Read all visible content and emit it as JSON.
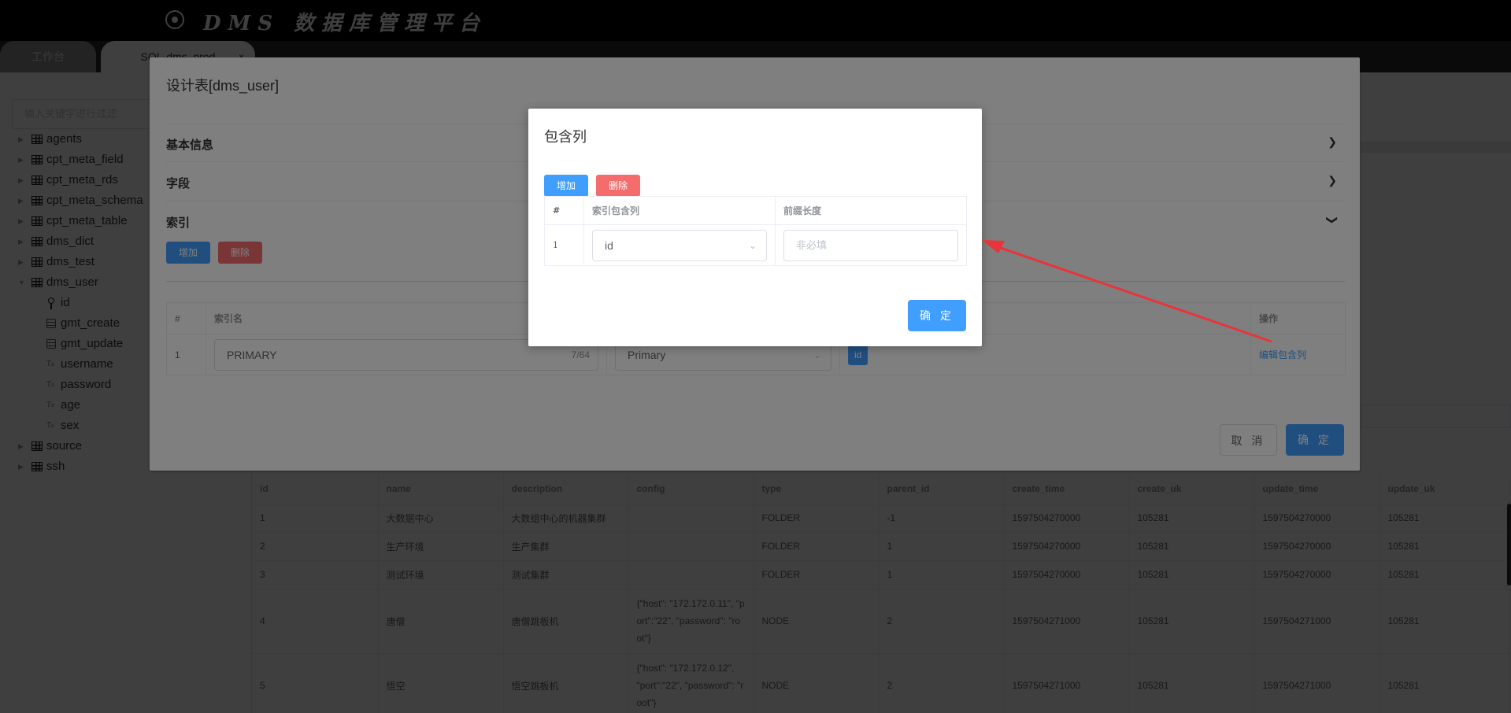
{
  "app": {
    "title": "DMS 数据库管理平台",
    "logo_icon": "gear-logo-icon"
  },
  "tabs": [
    {
      "label": "工作台"
    },
    {
      "label": "SQL-dms_prod",
      "close": "×"
    }
  ],
  "sidebar": {
    "filter_placeholder": "输入关键字进行过滤",
    "tables": [
      {
        "name": "agents"
      },
      {
        "name": "cpt_meta_field"
      },
      {
        "name": "cpt_meta_rds"
      },
      {
        "name": "cpt_meta_schema"
      },
      {
        "name": "cpt_meta_table"
      },
      {
        "name": "dms_dict"
      },
      {
        "name": "dms_test"
      },
      {
        "name": "dms_user",
        "expanded": true,
        "columns": [
          {
            "name": "id",
            "icon": "key-icon"
          },
          {
            "name": "gmt_create",
            "icon": "datetime-icon"
          },
          {
            "name": "gmt_update",
            "icon": "datetime-icon"
          },
          {
            "name": "username",
            "icon": "text-icon"
          },
          {
            "name": "password",
            "icon": "text-icon"
          },
          {
            "name": "age",
            "icon": "text-icon"
          },
          {
            "name": "sex",
            "icon": "text-icon"
          }
        ]
      },
      {
        "name": "source"
      },
      {
        "name": "ssh"
      }
    ]
  },
  "result_table": {
    "headers": [
      "id",
      "name",
      "description",
      "config",
      "type",
      "parent_id",
      "create_time",
      "create_uk",
      "update_time",
      "update_uk"
    ],
    "rows": [
      [
        "1",
        "大数据中心",
        "大数组中心的机器集群",
        "",
        "FOLDER",
        "-1",
        "1597504270000",
        "105281",
        "1597504270000",
        "105281"
      ],
      [
        "2",
        "生产环境",
        "生产集群",
        "",
        "FOLDER",
        "1",
        "1597504270000",
        "105281",
        "1597504270000",
        "105281"
      ],
      [
        "3",
        "测试环境",
        "测试集群",
        "",
        "FOLDER",
        "1",
        "1597504270000",
        "105281",
        "1597504270000",
        "105281"
      ],
      [
        "4",
        "唐僧",
        "唐僧跳板机",
        "{\"host\": \"172.172.0.11\", \"port\":\"22\", \"password\": \"root\"}",
        "NODE",
        "2",
        "1597504271000",
        "105281",
        "1597504271000",
        "105281"
      ],
      [
        "5",
        "悟空",
        "悟空跳板机",
        "{\"host\": \"172.172.0.12\", \"port\":\"22\", \"password\": \"root\"}",
        "NODE",
        "2",
        "1597504271000",
        "105281",
        "1597504271000",
        "105281"
      ]
    ]
  },
  "design_dialog": {
    "title": "设计表[dms_user]",
    "sections": {
      "basic": "基本信息",
      "fields": "字段",
      "index": "索引"
    },
    "add_label": "增加",
    "delete_label": "删除",
    "index_table": {
      "headers": {
        "num": "#",
        "name": "索引名",
        "ops": "操作"
      },
      "row": {
        "num": "1",
        "name": "PRIMARY",
        "name_count": "7/64",
        "type": "Primary",
        "column": "id",
        "edit_link": "编辑包含列"
      }
    },
    "cancel_label": "取 消",
    "confirm_label": "确 定"
  },
  "include_dialog": {
    "title": "包含列",
    "add_label": "增加",
    "delete_label": "删除",
    "headers": {
      "num": "#",
      "column": "索引包含列",
      "prefix": "前缀长度"
    },
    "row": {
      "num": "1",
      "column": "id",
      "prefix_placeholder": "非必填"
    },
    "confirm_label": "确 定"
  },
  "annotation": {
    "arrow_color": "#e8343a"
  }
}
